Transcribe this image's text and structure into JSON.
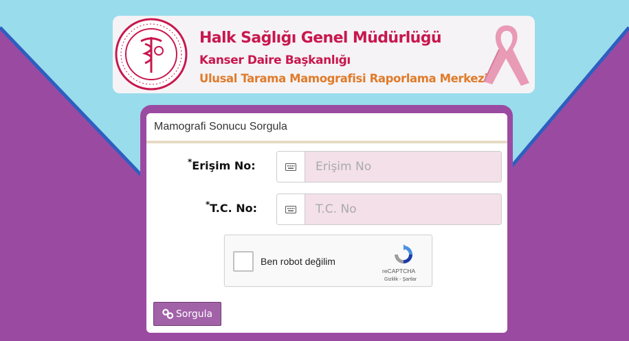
{
  "colors": {
    "background_purple": "#9b4aa2",
    "sky_blue": "#99dcec",
    "accent_blue": "#2e5fbf",
    "brand_red": "#c8174e",
    "brand_orange": "#e07b2a",
    "input_pink": "#f3e0e8",
    "button_purple": "#a262a8"
  },
  "header": {
    "title": "Halk Sağlığı Genel Müdürlüğü",
    "subtitle": "Kanser Daire Başkanlığı",
    "center": "Ulusal Tarama Mamografisi Raporlama Merkezi",
    "seal_icon": "ministry-seal-icon",
    "ribbon_icon": "pink-ribbon-icon"
  },
  "form": {
    "title": "Mamografi Sonucu Sorgula",
    "required_mark": "*",
    "access_no": {
      "label": "Erişim No:",
      "placeholder": "Erişim No",
      "icon": "keyboard-icon"
    },
    "tc_no": {
      "label": "T.C. No:",
      "placeholder": "T.C. No",
      "icon": "keyboard-icon"
    },
    "captcha": {
      "label": "Ben robot değilim",
      "brand": "reCAPTCHA",
      "links": "Gizlilik - Şartlar",
      "icon": "recaptcha-icon"
    },
    "submit": {
      "label": "Sorgula",
      "icon": "link-icon"
    }
  }
}
